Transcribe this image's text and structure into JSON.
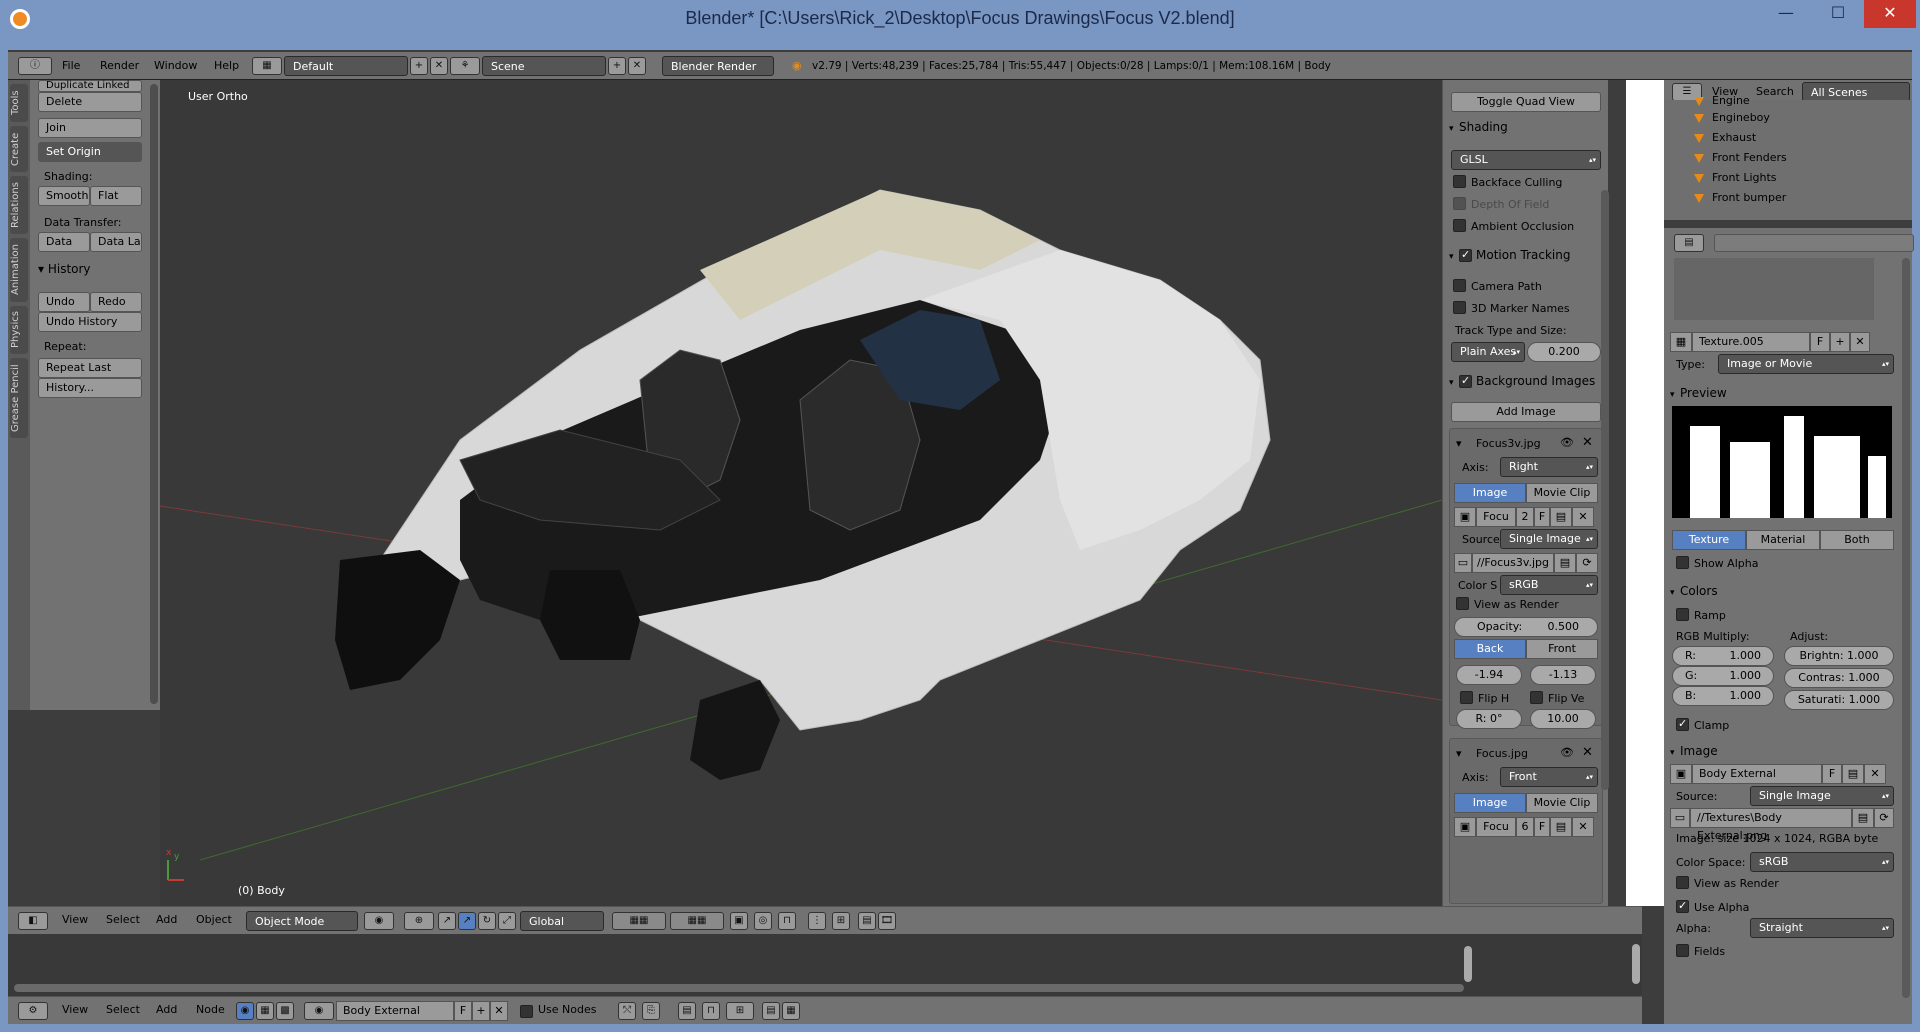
{
  "window": {
    "title": "Blender* [C:\\Users\\Rick_2\\Desktop\\Focus Drawings\\Focus V2.blend]",
    "controls": {
      "minimize": "—",
      "maximize": "☐",
      "close": "✕"
    }
  },
  "info_header": {
    "menus": [
      "File",
      "Render",
      "Window",
      "Help"
    ],
    "layout": "Default",
    "scene": "Scene",
    "engine": "Blender Render",
    "stats": "v2.79 | Verts:48,239 | Faces:25,784 | Tris:55,447 | Objects:0/28 | Lamps:0/1 | Mem:108.16M | Body"
  },
  "tool_tabs": [
    "Tools",
    "Create",
    "Relations",
    "Animation",
    "Physics",
    "Grease Pencil"
  ],
  "tool_shelf": {
    "top_items": [
      "Duplicate Linked",
      "Delete"
    ],
    "join": "Join",
    "set_origin": "Set Origin",
    "shading_label": "Shading:",
    "smooth": "Smooth",
    "flat": "Flat",
    "data_transfer_label": "Data Transfer:",
    "data": "Data",
    "data_la": "Data La",
    "history_header": "History",
    "undo": "Undo",
    "redo": "Redo",
    "undo_history": "Undo History",
    "repeat_label": "Repeat:",
    "repeat_last": "Repeat Last",
    "history_btn": "History..."
  },
  "viewport": {
    "label": "User Ortho",
    "object": "(0) Body",
    "axis_x": "x",
    "axis_y": "y"
  },
  "npanel": {
    "toggle_quad": "Toggle Quad View",
    "shading_header": "Shading",
    "shading_mode": "GLSL",
    "backface": "Backface Culling",
    "dof": "Depth Of Field",
    "ao": "Ambient Occlusion",
    "motion_header": "Motion Tracking",
    "camera_path": "Camera Path",
    "marker_names": "3D Marker Names",
    "track_label": "Track Type and Size:",
    "track_type": "Plain Axes",
    "track_size": "0.200",
    "bg_header": "Background Images",
    "add_image": "Add Image",
    "bg1": {
      "name": "Focus3v.jpg",
      "axis_label": "Axis:",
      "axis": "Right",
      "image_tab": "Image",
      "movie_tab": "Movie Clip",
      "img_name": "Focu",
      "users": "2",
      "f": "F",
      "source_label": "Source",
      "source": "Single Image",
      "path": "//Focus3v.jpg",
      "color_label": "Color S",
      "color": "sRGB",
      "view_render": "View as Render",
      "opacity_label": "Opacity:",
      "opacity": "0.500",
      "back": "Back",
      "front": "Front",
      "x": "-1.94",
      "y": "-1.13",
      "flip_h": "Flip H",
      "flip_v": "Flip Ve",
      "rot": "R: 0°",
      "size": "10.00"
    },
    "bg2": {
      "name": "Focus.jpg",
      "axis_label": "Axis:",
      "axis": "Front",
      "image_tab": "Image",
      "movie_tab": "Movie Clip",
      "img_name": "Focu",
      "users": "6",
      "f": "F"
    }
  },
  "outliner": {
    "menus": [
      "View",
      "Search"
    ],
    "scenes": "All Scenes",
    "rows": [
      "Engine",
      "Engineboy",
      "Exhaust",
      "Front Fenders",
      "Front Lights",
      "Front bumper"
    ]
  },
  "properties": {
    "texture_name": "Texture.005",
    "f": "F",
    "type_label": "Type:",
    "type": "Image or Movie",
    "preview_header": "Preview",
    "tabs": [
      "Texture",
      "Material",
      "Both"
    ],
    "show_alpha": "Show Alpha",
    "colors_header": "Colors",
    "ramp": "Ramp",
    "rgb_label": "RGB Multiply:",
    "adjust_label": "Adjust:",
    "r": "R:",
    "g": "G:",
    "b": "B:",
    "rv": "1.000",
    "gv": "1.000",
    "bv": "1.000",
    "brightness": "Brightn: 1.000",
    "contrast": "Contras: 1.000",
    "saturation": "Saturati: 1.000",
    "clamp": "Clamp",
    "image_header": "Image",
    "image_name": "Body External",
    "source_label": "Source:",
    "source": "Single Image",
    "path": "//Textures\\Body External.png",
    "size_info": "Image: size 1024 x 1024, RGBA byte",
    "colorspace_label": "Color Space:",
    "colorspace": "sRGB",
    "view_render": "View as Render",
    "use_alpha": "Use Alpha",
    "alpha_label": "Alpha:",
    "alpha": "Straight",
    "fields": "Fields"
  },
  "vp_header": {
    "menus": [
      "View",
      "Select",
      "Add",
      "Object"
    ],
    "mode": "Object Mode",
    "orientation": "Global"
  },
  "node_header": {
    "menus": [
      "View",
      "Select",
      "Add",
      "Node"
    ],
    "material": "Body External",
    "f": "F",
    "use_nodes": "Use Nodes"
  },
  "colors": {
    "accent_blue": "#5680c2",
    "panel_gray": "#727272",
    "viewport": "#393939",
    "close_red": "#c9362c",
    "object_orange": "#e68a1a"
  }
}
